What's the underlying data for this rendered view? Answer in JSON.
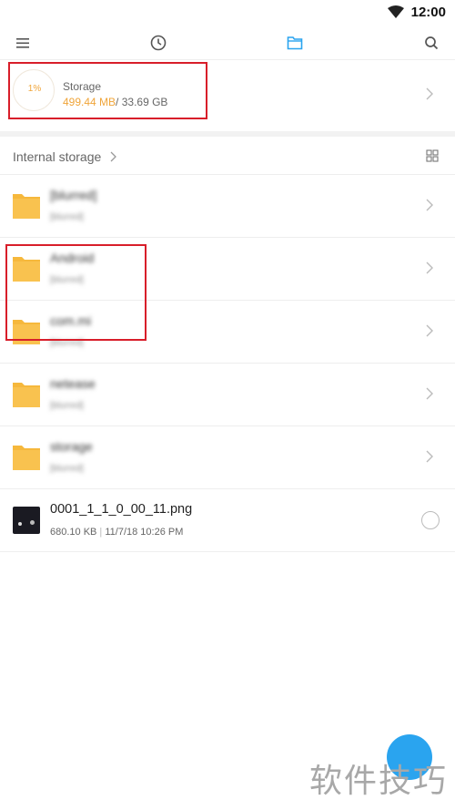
{
  "status_bar": {
    "time": "12:00"
  },
  "toolbar": {
    "icons": [
      "menu-icon",
      "recent-icon",
      "files-icon",
      "search-icon"
    ],
    "active_icon": "files-icon",
    "accent_color": "#2aa4ef"
  },
  "storage": {
    "percent": "1%",
    "title": "Storage",
    "used": "499.44 MB",
    "total": "/ 33.69 GB",
    "used_color": "#f0a53a"
  },
  "breadcrumb": {
    "label": "Internal storage"
  },
  "folders": [
    {
      "name": "[blurred]",
      "meta": "[blurred]"
    },
    {
      "name": "Android",
      "meta": "[blurred]"
    },
    {
      "name": "com.mi",
      "meta": "[blurred]"
    },
    {
      "name": "netease",
      "meta": "[blurred]"
    },
    {
      "name": "storage",
      "meta": "[blurred]"
    }
  ],
  "file": {
    "name": "0001_1_1_0_00_11.png",
    "size": "680.10 KB",
    "date": "11/7/18 10:26 PM"
  },
  "watermark": "软件技巧",
  "annotation_color": "#d81e2a",
  "folder_color": "#f6b83c"
}
